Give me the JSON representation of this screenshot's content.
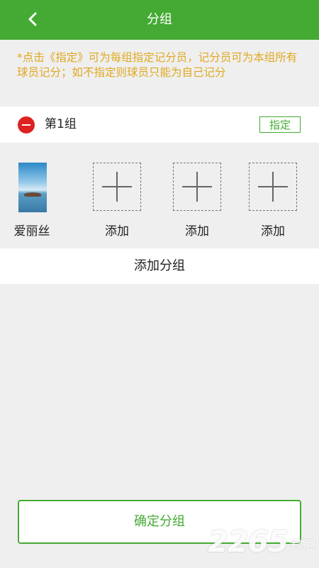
{
  "header": {
    "title": "分组",
    "back_icon": "chevron-left-icon",
    "background": "#44aa33"
  },
  "notice": {
    "text": "*点击《指定》可为每组指定记分员，记分员可为本组所有球员记分；如不指定则球员只能为自己记分",
    "color": "#e0a820"
  },
  "group": {
    "remove_icon": "minus-circle-icon",
    "name": "第1组",
    "assign_label": "指定"
  },
  "members": [
    {
      "type": "player",
      "label": "爱丽丝"
    },
    {
      "type": "add",
      "label": "添加"
    },
    {
      "type": "add",
      "label": "添加"
    },
    {
      "type": "add",
      "label": "添加"
    }
  ],
  "add_group_label": "添加分组",
  "confirm_label": "确定分组",
  "watermark": {
    "main": "2265",
    "sub": "手游网"
  }
}
